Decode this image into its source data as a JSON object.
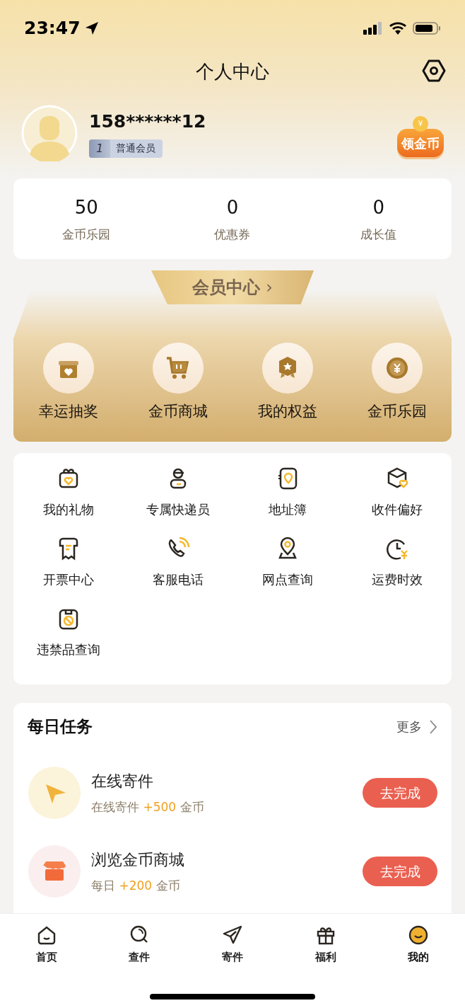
{
  "status_bar": {
    "time": "23:47"
  },
  "header": {
    "title": "个人中心"
  },
  "profile": {
    "phone": "158******12",
    "level": "1",
    "level_name": "普通会员",
    "coin_badge": "领金币",
    "coin_symbol": "¥"
  },
  "stats": [
    {
      "value": "50",
      "label": "金币乐园"
    },
    {
      "value": "0",
      "label": "优惠券"
    },
    {
      "value": "0",
      "label": "成长值"
    }
  ],
  "member_center": {
    "title": "会员中心",
    "chevron": "›",
    "items": [
      {
        "label": "幸运抽奖"
      },
      {
        "label": "金币商城"
      },
      {
        "label": "我的权益"
      },
      {
        "label": "金币乐园"
      }
    ]
  },
  "services": [
    {
      "label": "我的礼物"
    },
    {
      "label": "专属快递员"
    },
    {
      "label": "地址簿"
    },
    {
      "label": "收件偏好"
    },
    {
      "label": "开票中心"
    },
    {
      "label": "客服电话"
    },
    {
      "label": "网点查询"
    },
    {
      "label": "运费时效"
    },
    {
      "label": "违禁品查询"
    }
  ],
  "daily_tasks": {
    "title": "每日任务",
    "more": "更多",
    "tasks": [
      {
        "title": "在线寄件",
        "desc_prefix": "在线寄件",
        "bonus": "+500",
        "desc_suffix": "金币",
        "button": "去完成"
      },
      {
        "title": "浏览金币商城",
        "desc_prefix": "每日",
        "bonus": "+200",
        "desc_suffix": "金币",
        "button": "去完成"
      }
    ]
  },
  "tab_bar": [
    {
      "label": "首页",
      "selected": false
    },
    {
      "label": "查件",
      "selected": false
    },
    {
      "label": "寄件",
      "selected": false
    },
    {
      "label": "福利",
      "selected": false
    },
    {
      "label": "我的",
      "selected": true
    }
  ]
}
